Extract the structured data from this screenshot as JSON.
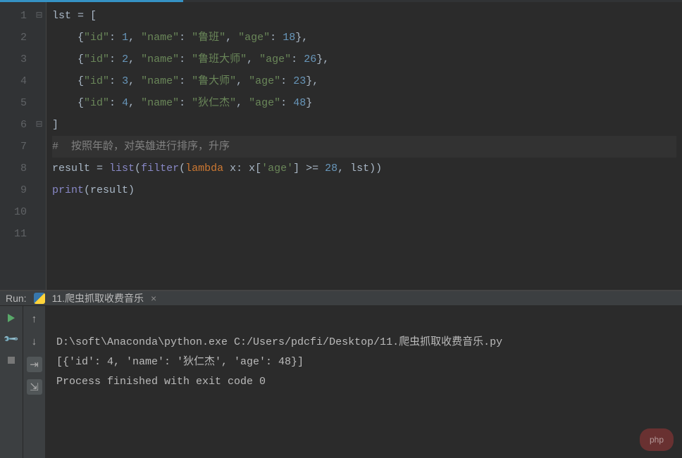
{
  "lines": {
    "n1": "1",
    "n2": "2",
    "n3": "3",
    "n4": "4",
    "n5": "5",
    "n6": "6",
    "n7": "7",
    "n8": "8",
    "n9": "9",
    "n10": "10",
    "n11": "11"
  },
  "code": {
    "l1": {
      "var": "lst",
      "eq": " = [",
      "indent": ""
    },
    "rows": [
      {
        "id": "1",
        "name": "\"鲁班\"",
        "age": "18",
        "tail": ","
      },
      {
        "id": "2",
        "name": "\"鲁班大师\"",
        "age": "26",
        "tail": ","
      },
      {
        "id": "3",
        "name": "\"鲁大师\"",
        "age": "23",
        "tail": ","
      },
      {
        "id": "4",
        "name": "\"狄仁杰\"",
        "age": "48",
        "tail": ""
      }
    ],
    "close": "]",
    "comment": "#  按照年龄，对英雄进行排序，升序",
    "l8": {
      "var": "result",
      "eq": " = ",
      "list": "list",
      "filter": "filter",
      "lambda": "lambda",
      "x": " x: x[",
      "key": "'age'",
      "cmp": "] >= ",
      "val": "28",
      "rest": ", lst))"
    },
    "l9": {
      "print": "print",
      "arg": "(result)"
    }
  },
  "run": {
    "label": "Run:",
    "tab": "11.爬虫抓取收费音乐",
    "close": "×",
    "out1": "D:\\soft\\Anaconda\\python.exe C:/Users/pdcfi/Desktop/11.爬虫抓取收费音乐.py",
    "out2": "[{'id': 4, 'name': '狄仁杰', 'age': 48}]",
    "out3": "",
    "out4": "Process finished with exit code 0"
  },
  "watermark": "php"
}
